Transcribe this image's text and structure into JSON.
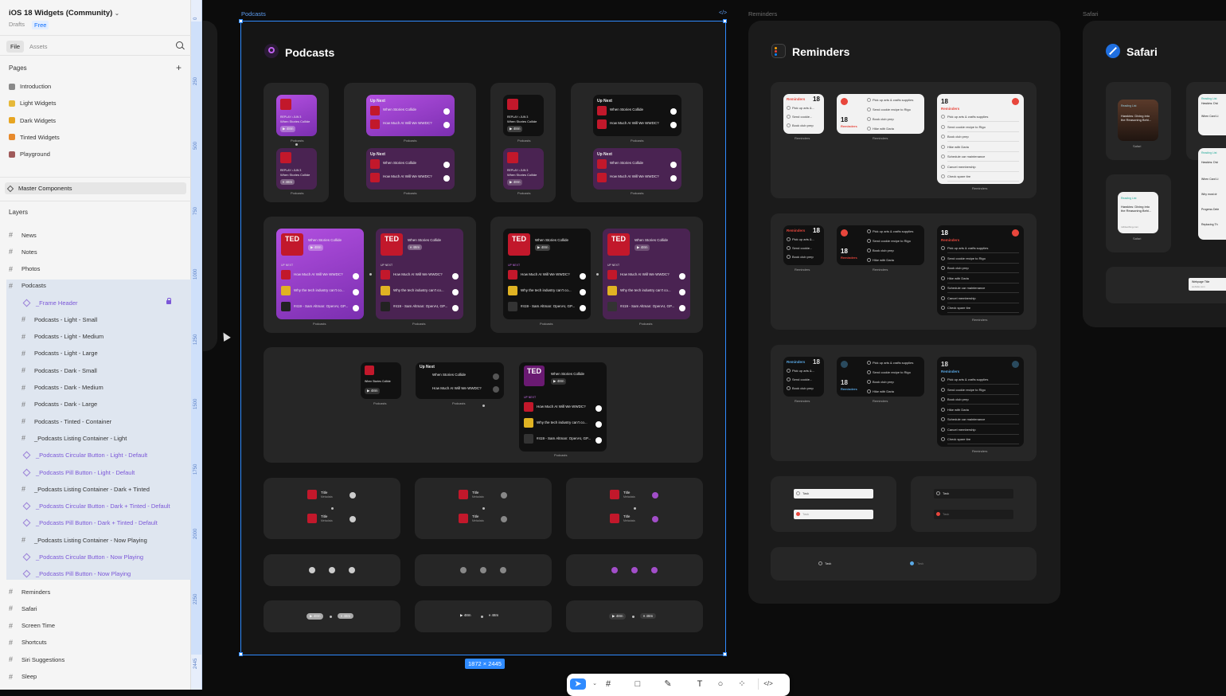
{
  "file": {
    "title": "iOS 18 Widgets (Community)",
    "location": "Drafts",
    "plan": "Free"
  },
  "tabs": {
    "file": "File",
    "assets": "Assets"
  },
  "pages": {
    "heading": "Pages",
    "items": [
      {
        "label": "Introduction",
        "color": "#8a8a8a"
      },
      {
        "label": "Light Widgets",
        "color": "#e6b93a"
      },
      {
        "label": "Dark Widgets",
        "color": "#e7a521"
      },
      {
        "label": "Tinted Widgets",
        "color": "#e78a2c"
      },
      {
        "label": "Playground",
        "color": "#a05a5a"
      }
    ]
  },
  "master_components": "Master Components",
  "layers": {
    "heading": "Layers",
    "top": [
      "News",
      "Notes",
      "Photos",
      "Podcasts"
    ],
    "podcast_children": [
      "_Frame Header",
      "Podcasts - Light - Small",
      "Podcasts - Light - Medium",
      "Podcasts - Light - Large",
      "Podcasts - Dark - Small",
      "Podcasts - Dark - Medium",
      "Podcasts - Dark - Large",
      "Podcasts - Tinted - Container",
      "_Podcasts Listing Container - Light",
      "_Podcasts Circular Button - Light - Default",
      "_Podcasts Pill Button - Light - Default",
      "_Podcasts Listing Container - Dark + Tinted",
      "_Podcasts Circular Button - Dark + Tinted - Default",
      "_Podcasts Pill Button - Dark + Tinted - Default",
      "_Podcasts Listing Container - Now Playing",
      "_Podcasts Circular Button - Now Playing",
      "_Podcasts Pill Button - Now Playing"
    ],
    "bottom": [
      "Reminders",
      "Safari",
      "Screen Time",
      "Shortcuts",
      "Siri Suggestions",
      "Sleep"
    ]
  },
  "ruler": [
    "0",
    "250",
    "500",
    "750",
    "1000",
    "1250",
    "1500",
    "1750",
    "2000",
    "2250",
    "2445"
  ],
  "canvas": {
    "frames": {
      "podcasts": "Podcasts",
      "reminders": "Reminders",
      "safari": "Safari"
    },
    "dimensions": "1872 × 2445",
    "podcasts": {
      "title": "Podcasts",
      "caption": "Podcasts",
      "up_next": "Up Next",
      "up_next_caps": "UP NEXT",
      "ep_meta": "REPLAY • JUN 3",
      "ep1": "When Stories Collide",
      "ep2": "How Much AI Will We WWDC?",
      "ep3": "Why the tech industry can't co...",
      "ep4": "#419 - Sam Altman: OpenAI, GP...",
      "time": "48m",
      "resume1": "Resume • Jun 3 • 48m left",
      "resume2": "14 ago • 1h 25m",
      "track_title": "Title",
      "track_sub": "Metadata",
      "ted1": "TED",
      "ted2": "RADIO",
      "ted3": "HOUR"
    },
    "reminders": {
      "title": "Reminders",
      "caption": "Reminders",
      "count": "18",
      "list_name": "Reminders",
      "short_items": [
        "Pick up arts &...",
        "Send cookie...",
        "Book club prep"
      ],
      "items": [
        "Pick up arts & crafts supplies",
        "Send cookie recipe to Rigo",
        "Book club prep",
        "Hike with Daria",
        "Schedule car maintenance",
        "Cancel membership",
        "Check spare tire"
      ],
      "task": "Task"
    },
    "safari": {
      "title": "Safari",
      "caption": "Safari",
      "reading_list": "Reading List",
      "article": "Hawkins: Diving into the Reasoning Behi...",
      "site": "rolfdesthing.com",
      "side1": "Hawkins: Divi",
      "side2": "When Card Li",
      "side3": "Why most dr",
      "side4": "Progress Dele",
      "side5": "Replacing Th",
      "webpage_title": "Webpage Title",
      "webpage_url": "website.com"
    }
  },
  "toolbar": [
    "move",
    "frame",
    "shape",
    "pen",
    "text",
    "comment",
    "actions",
    "dev-mode"
  ]
}
